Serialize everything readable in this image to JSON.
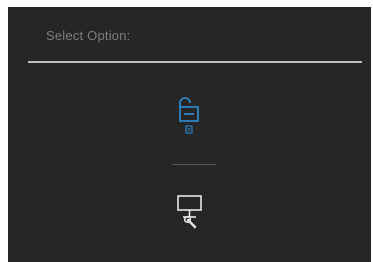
{
  "menu": {
    "title": "Select Option:",
    "options": [
      {
        "name": "unlock",
        "icon": "unlock-icon",
        "color": "#2f8fd6"
      },
      {
        "name": "monitor-settings",
        "icon": "monitor-wrench-icon",
        "color": "#e6e6e6"
      }
    ]
  },
  "colors": {
    "background": "#262626",
    "title_text": "#7d7d7d",
    "divider": "#bdbdbd",
    "accent": "#2f8fd6"
  }
}
